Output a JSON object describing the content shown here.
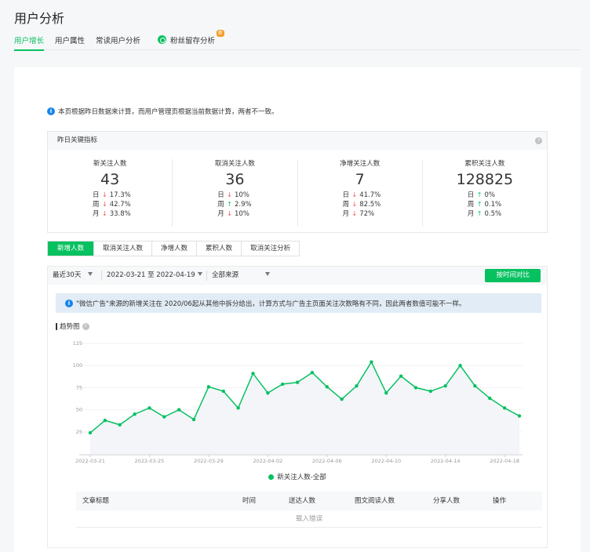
{
  "page": {
    "title": "用户分析",
    "tabs": [
      {
        "label": "用户增长",
        "active": true
      },
      {
        "label": "用户属性",
        "active": false
      },
      {
        "label": "常读用户分析",
        "active": false
      },
      {
        "label": "粉丝留存分析",
        "active": false,
        "badge": "新",
        "icon": "fan-retention-icon"
      }
    ]
  },
  "notice": "本页根据昨日数据来计算，而用户管理页根据当前数据计算，两者不一致。",
  "kpi": {
    "header": "昨日关键指标",
    "period_labels": [
      "日",
      "周",
      "月"
    ],
    "items": [
      {
        "title": "新关注人数",
        "value": "43",
        "changes": [
          {
            "dir": "down",
            "text": "17.3%"
          },
          {
            "dir": "down",
            "text": "42.7%"
          },
          {
            "dir": "down",
            "text": "33.8%"
          }
        ]
      },
      {
        "title": "取消关注人数",
        "value": "36",
        "changes": [
          {
            "dir": "down",
            "text": "10%"
          },
          {
            "dir": "up",
            "text": "2.9%"
          },
          {
            "dir": "down",
            "text": "10%"
          }
        ]
      },
      {
        "title": "净增关注人数",
        "value": "7",
        "changes": [
          {
            "dir": "down",
            "text": "41.7%"
          },
          {
            "dir": "down",
            "text": "82.5%"
          },
          {
            "dir": "down",
            "text": "72%"
          }
        ]
      },
      {
        "title": "累积关注人数",
        "value": "128825",
        "changes": [
          {
            "dir": "up",
            "text": "0%"
          },
          {
            "dir": "up",
            "text": "0.1%"
          },
          {
            "dir": "up",
            "text": "0.5%"
          }
        ]
      }
    ]
  },
  "metric_tabs": [
    {
      "label": "新增人数",
      "active": true
    },
    {
      "label": "取消关注人数",
      "active": false
    },
    {
      "label": "净增人数",
      "active": false
    },
    {
      "label": "累积人数",
      "active": false
    },
    {
      "label": "取消关注分析",
      "active": false
    }
  ],
  "filters": {
    "range": "最近30天",
    "dates": "2022-03-21 至 2022-04-19",
    "source": "全部来源",
    "compare_button": "按时间对比"
  },
  "chart_notice": "\"微信广告\"来源的新增关注在 2020/06起从其他中拆分给出，计算方式与广告主页面关注次数略有不同，因此两者数值可能不一样。",
  "trend_title": "趋势图",
  "chart_data": {
    "type": "line",
    "x": [
      "2022-03-21",
      "2022-03-22",
      "2022-03-23",
      "2022-03-24",
      "2022-03-25",
      "2022-03-26",
      "2022-03-27",
      "2022-03-28",
      "2022-03-29",
      "2022-03-30",
      "2022-03-31",
      "2022-04-01",
      "2022-04-02",
      "2022-04-03",
      "2022-04-04",
      "2022-04-05",
      "2022-04-06",
      "2022-04-07",
      "2022-04-08",
      "2022-04-09",
      "2022-04-10",
      "2022-04-11",
      "2022-04-12",
      "2022-04-13",
      "2022-04-14",
      "2022-04-15",
      "2022-04-16",
      "2022-04-17",
      "2022-04-18",
      "2022-04-19"
    ],
    "x_tick_labels": [
      "2022-03-21",
      "2022-03-25",
      "2022-03-29",
      "2022-04-02",
      "2022-04-06",
      "2022-04-10",
      "2022-04-14",
      "2022-04-18"
    ],
    "series": [
      {
        "name": "新关注人数-全部",
        "color": "#07c160",
        "values": [
          24,
          38,
          33,
          45,
          52,
          42,
          50,
          39,
          76,
          71,
          52,
          91,
          69,
          79,
          81,
          92,
          76,
          62,
          77,
          104,
          69,
          88,
          75,
          71,
          77,
          100,
          77,
          63,
          52,
          43
        ]
      }
    ],
    "y_ticks": [
      25,
      50,
      75,
      100,
      125
    ],
    "ylim": [
      0,
      125
    ],
    "grid": true
  },
  "table": {
    "columns": [
      "文章标题",
      "时间",
      "送达人数",
      "图文阅读人数",
      "分享人数",
      "操作"
    ],
    "empty_text": "载入错误"
  }
}
